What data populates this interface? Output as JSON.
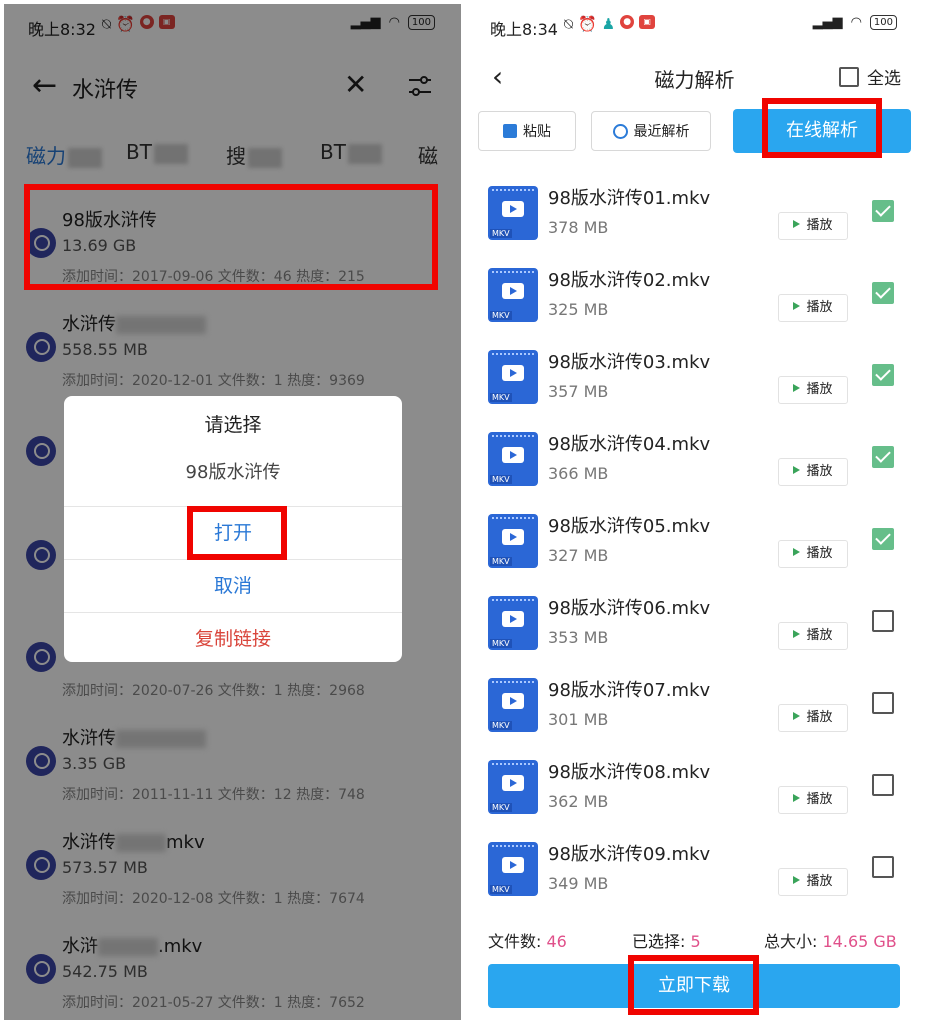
{
  "left": {
    "status": {
      "time": "晚上8:32",
      "battery": "100"
    },
    "search": {
      "query": "水浒传"
    },
    "tabs": [
      "磁力",
      "BT",
      "搜",
      "BT",
      "磁"
    ],
    "results": [
      {
        "title": "98版水浒传",
        "size": "13.69 GB",
        "meta": "添加时间：2017-09-06  文件数：46  热度：215"
      },
      {
        "title": "水浒传",
        "size": "558.55 MB",
        "meta": "添加时间：2020-12-01  文件数：1  热度：9369"
      },
      {
        "title": "",
        "size": "",
        "meta": "添加时间：2020-07-26  文件数：1  热度：2968"
      },
      {
        "title": "水浒传",
        "size": "3.35 GB",
        "meta": "添加时间：2011-11-11  文件数：12  热度：748"
      },
      {
        "title": "水浒传",
        "suffix": "mkv",
        "size": "573.57 MB",
        "meta": "添加时间：2020-12-08  文件数：1  热度：7674"
      },
      {
        "title": "水浒",
        "suffix": ".mkv",
        "size": "542.75 MB",
        "meta": "添加时间：2021-05-27  文件数：1  热度：7652"
      }
    ],
    "dialog": {
      "title": "请选择",
      "message": "98版水浒传",
      "open": "打开",
      "cancel": "取消",
      "copy_link": "复制链接"
    }
  },
  "right": {
    "status": {
      "time": "晚上8:34",
      "battery": "100"
    },
    "nav": {
      "title": "磁力解析",
      "select_all": "全选"
    },
    "toolbar": {
      "paste": "粘贴",
      "recent": "最近解析",
      "online": "在线解析"
    },
    "play_label": "播放",
    "files": [
      {
        "name": "98版水浒传01.mkv",
        "size": "378 MB",
        "checked": true
      },
      {
        "name": "98版水浒传02.mkv",
        "size": "325 MB",
        "checked": true
      },
      {
        "name": "98版水浒传03.mkv",
        "size": "357 MB",
        "checked": true
      },
      {
        "name": "98版水浒传04.mkv",
        "size": "366 MB",
        "checked": true
      },
      {
        "name": "98版水浒传05.mkv",
        "size": "327 MB",
        "checked": true
      },
      {
        "name": "98版水浒传06.mkv",
        "size": "353 MB",
        "checked": false
      },
      {
        "name": "98版水浒传07.mkv",
        "size": "301 MB",
        "checked": false
      },
      {
        "name": "98版水浒传08.mkv",
        "size": "362 MB",
        "checked": false
      },
      {
        "name": "98版水浒传09.mkv",
        "size": "349 MB",
        "checked": false
      }
    ],
    "summary": {
      "file_count_label": "文件数:",
      "file_count": "46",
      "selected_label": "已选择:",
      "selected": "5",
      "total_label": "总大小:",
      "total": "14.65 GB"
    },
    "download": "立即下载"
  },
  "colors": {
    "accent": "#2aa6ef",
    "highlight": "#f00400",
    "pink": "#e0508a",
    "check": "#66be8a"
  }
}
